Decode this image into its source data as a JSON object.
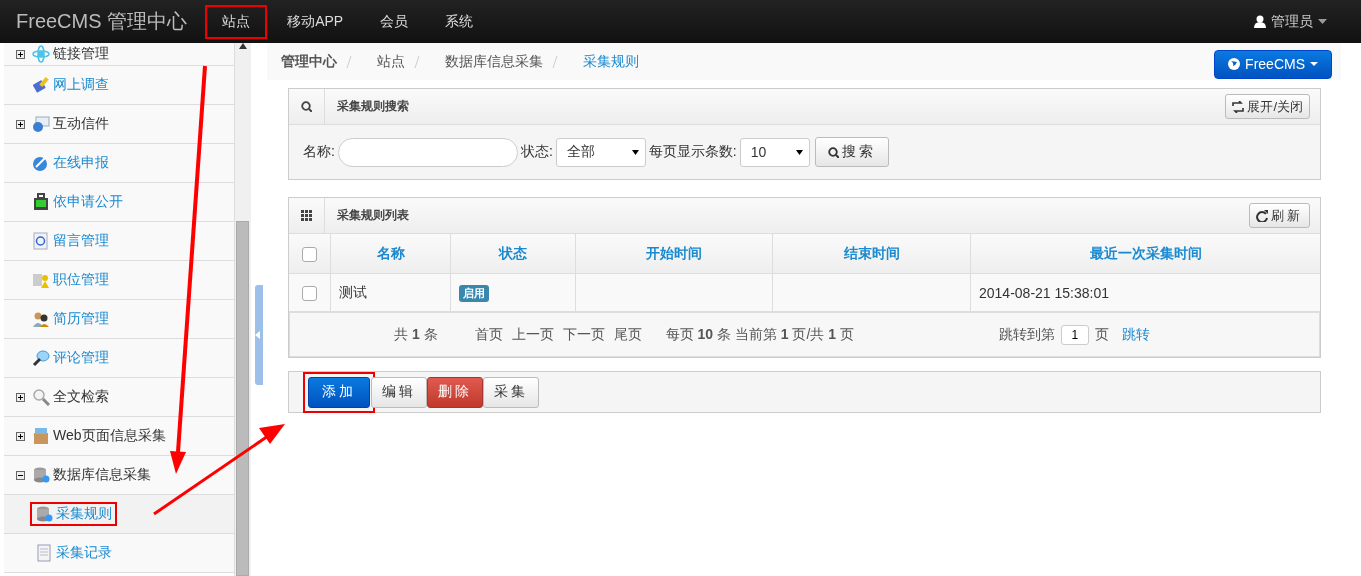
{
  "navbar": {
    "brand": "FreeCMS 管理中心",
    "user": "管理员",
    "items": [
      {
        "label": "站点",
        "highlighted": true
      },
      {
        "label": "移动APP",
        "highlighted": false
      },
      {
        "label": "会员",
        "highlighted": false
      },
      {
        "label": "系统",
        "highlighted": false
      }
    ]
  },
  "sidebar": {
    "items": [
      {
        "label": "链接管理",
        "kind": "group",
        "expanded": false
      },
      {
        "label": "网上调查",
        "kind": "link"
      },
      {
        "label": "互动信件",
        "kind": "group",
        "expanded": false
      },
      {
        "label": "在线申报",
        "kind": "link"
      },
      {
        "label": "依申请公开",
        "kind": "link"
      },
      {
        "label": "留言管理",
        "kind": "link"
      },
      {
        "label": "职位管理",
        "kind": "link"
      },
      {
        "label": "简历管理",
        "kind": "link"
      },
      {
        "label": "评论管理",
        "kind": "link"
      },
      {
        "label": "全文检索",
        "kind": "group",
        "expanded": false
      },
      {
        "label": "Web页面信息采集",
        "kind": "group",
        "expanded": false
      },
      {
        "label": "数据库信息采集",
        "kind": "group",
        "expanded": true,
        "children": [
          {
            "label": "采集规则",
            "selected": true,
            "highlighted": true
          },
          {
            "label": "采集记录",
            "selected": false,
            "highlighted": false
          }
        ]
      }
    ]
  },
  "breadcrumb": [
    {
      "label": "管理中心",
      "kind": "root"
    },
    {
      "label": "站点",
      "kind": "crumb"
    },
    {
      "label": "数据库信息采集",
      "kind": "crumb"
    },
    {
      "label": "采集规则",
      "kind": "current"
    }
  ],
  "site_button": "FreeCMS",
  "search_panel": {
    "title": "采集规则搜索",
    "toggle": "展开/关闭",
    "button": "搜索",
    "fields": [
      {
        "kind": "text",
        "label": "名称:"
      },
      {
        "kind": "select",
        "label": "状态:",
        "value": "全部"
      },
      {
        "kind": "select",
        "label": "每页显示条数:",
        "value": "10"
      }
    ]
  },
  "list_panel": {
    "title": "采集规则列表",
    "refresh": "刷新",
    "header_checked": false,
    "columns": [
      "名称",
      "状态",
      "开始时间",
      "结束时间",
      "最近一次采集时间"
    ],
    "rows": [
      {
        "checked": false,
        "name": "测试",
        "status": "启用",
        "last_collected": "2014-08-21 15:38:01"
      }
    ],
    "pager": {
      "total": "共 **1** 条",
      "links": [
        "首页",
        "上一页",
        "下一页",
        "尾页"
      ],
      "info": "每页 **10** 条 当前第 **1** 页/共 **1** 页",
      "jump_label": "跳转到第",
      "jump_value": "1",
      "jump_unit": "页",
      "jump_button": "跳转"
    }
  },
  "actions": [
    {
      "label": "添加",
      "kind": "primary",
      "highlighted": true
    },
    {
      "label": "编辑",
      "kind": "default",
      "highlighted": false
    },
    {
      "label": "删除",
      "kind": "danger",
      "highlighted": false
    },
    {
      "label": "采集",
      "kind": "default",
      "highlighted": false
    }
  ]
}
